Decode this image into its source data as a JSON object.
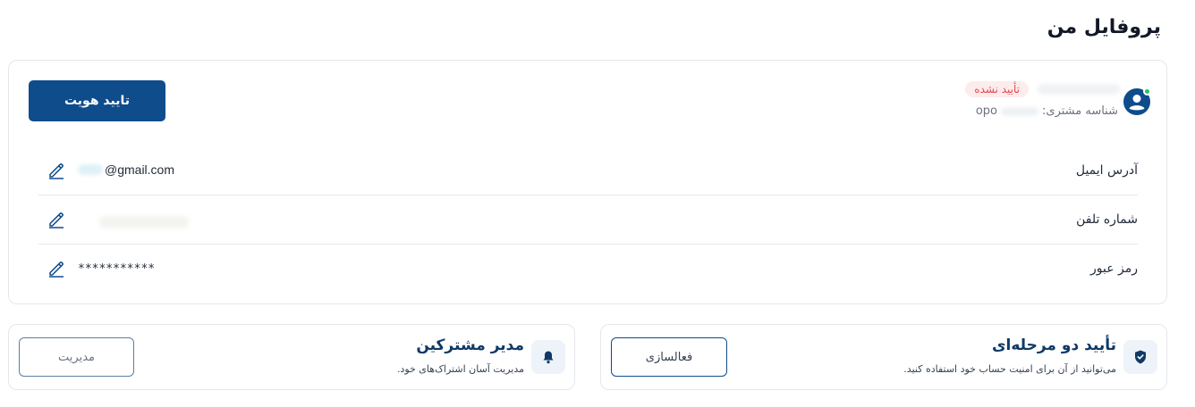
{
  "page": {
    "title": "پروفایل من"
  },
  "profile": {
    "status_badge": "تأیید نشده",
    "customer_id_label": "شناسه مشتری:",
    "customer_id_prefix": "opo",
    "verify_button": "تایید هویت",
    "rows": [
      {
        "label": "آدرس ایمیل",
        "value": "@gmail.com"
      },
      {
        "label": "شماره تلفن",
        "value": ""
      },
      {
        "label": "رمز عبور",
        "value": "***********"
      }
    ]
  },
  "two_factor": {
    "title": "تأیید دو مرحله‌ای",
    "description": "می‌توانید از آن برای امنیت حساب خود استفاده کنید.",
    "button": "فعالسازی"
  },
  "subscription_manager": {
    "title": "مدیر مشترکین",
    "description": "مدیریت آسان اشتراک‌های خود.",
    "button": "مدیریت"
  },
  "colors": {
    "primary": "#0f4c8c",
    "heading": "#0f3a66",
    "badge_bg": "#fdecec",
    "badge_text": "#e5484d",
    "online_dot": "#22c55e",
    "border": "#e5e7eb"
  },
  "icons": {
    "avatar": "user-circle-icon",
    "edit": "pencil-icon",
    "two_factor": "shield-check-icon",
    "subscriptions": "bell-icon"
  }
}
